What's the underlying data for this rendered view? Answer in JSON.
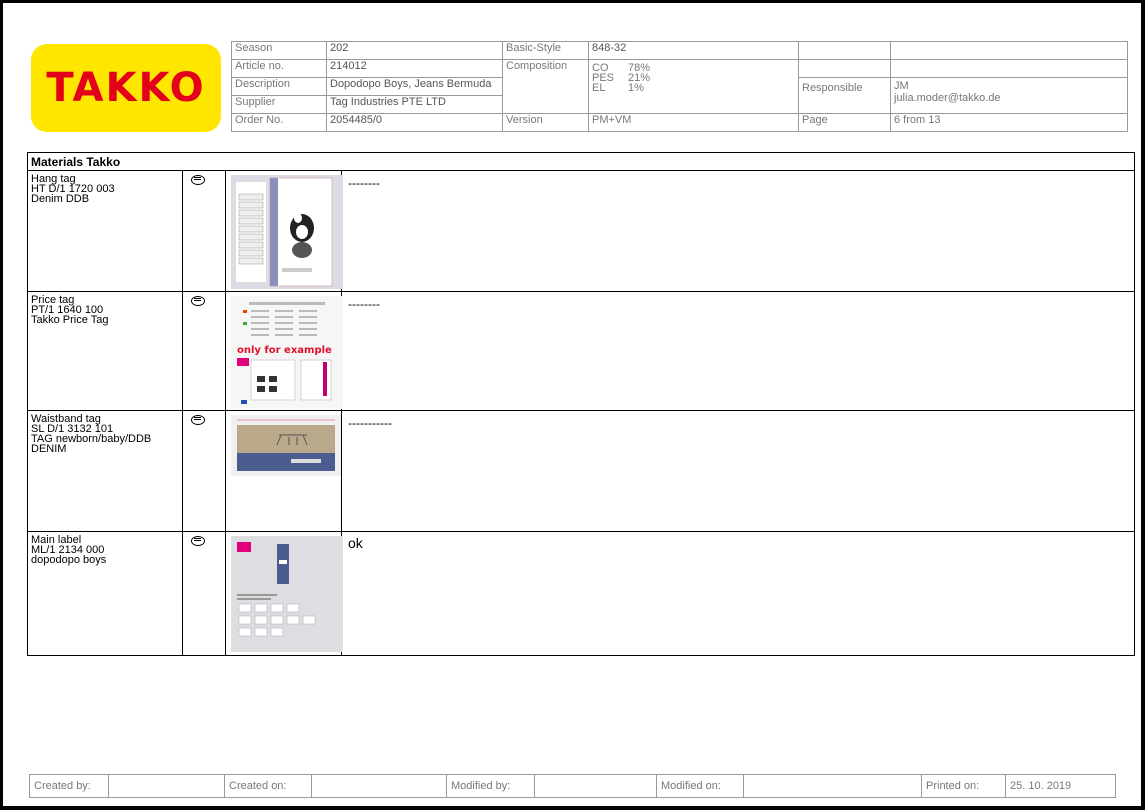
{
  "header": {
    "logo_text": "TAKKO",
    "season_label": "Season",
    "season_value": "202",
    "basic_style_label": "Basic-Style",
    "basic_style_value": "848-32",
    "article_label": "Article no.",
    "article_value": "214012",
    "composition_label": "Composition",
    "composition": [
      {
        "fiber": "CO",
        "pct": "78%"
      },
      {
        "fiber": "PES",
        "pct": "21%"
      },
      {
        "fiber": "EL",
        "pct": "1%"
      }
    ],
    "description_label": "Description",
    "description_value": "Dopodopo Boys, Jeans Bermuda",
    "responsible_label": "Responsible",
    "responsible_name": "JM",
    "responsible_email": "julia.moder@takko.de",
    "supplier_label": "Supplier",
    "supplier_value": "Tag Industries PTE LTD",
    "order_label": "Order No.",
    "order_value": "2054485/0",
    "version_label": "Version",
    "version_value": "PM+VM",
    "page_label": "Page",
    "page_value": "6 from 13"
  },
  "materials": {
    "title": "Materials Takko",
    "rows": [
      {
        "label": "Hang tag\nHT  D/1  1720 003\nDenim DDB",
        "note": "--------"
      },
      {
        "label": "Price tag\nPT/1  1640 100\nTakko Price Tag",
        "note": "--------",
        "example_text": "only for example"
      },
      {
        "label": "Waistband tag\nSL  D/1  3132 101\nTAG newborn/baby/DDB\nDENIM",
        "note": "-----------"
      },
      {
        "label": "Main label\nML/1  2134 000\ndopodopo boys",
        "note": "ok"
      }
    ]
  },
  "footer": {
    "created_by_label": "Created by:",
    "created_on_label": "Created on:",
    "modified_by_label": "Modified by:",
    "modified_on_label": "Modified on:",
    "printed_on_label": "Printed on:",
    "printed_on_value": "25. 10. 2019"
  },
  "colors": {
    "logo_bg": "#ffe600",
    "logo_text": "#e2001a",
    "waistband": "#4a5d8e"
  }
}
